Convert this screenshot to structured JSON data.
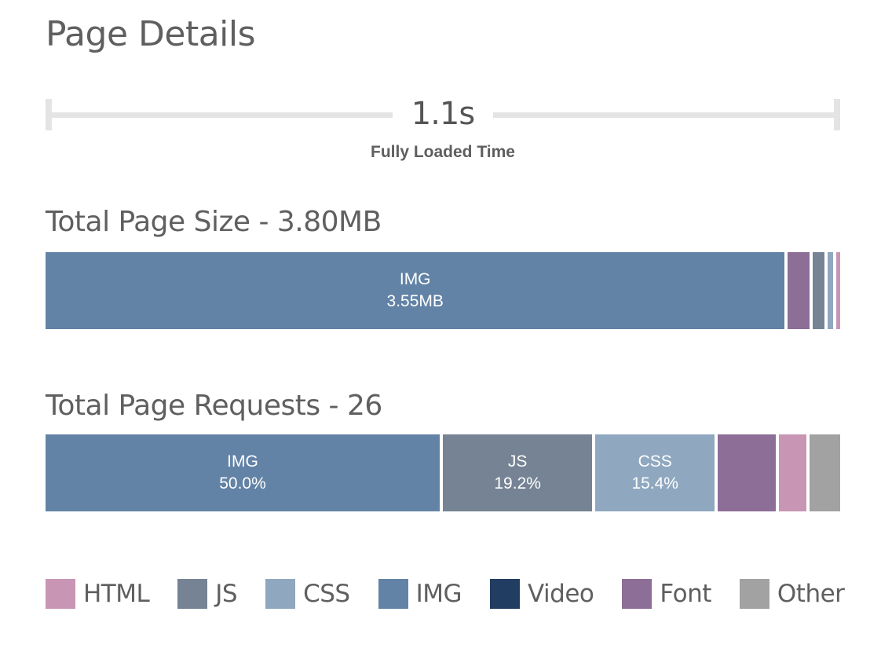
{
  "page_title": "Page Details",
  "timeline": {
    "value": "1.1s",
    "label": "Fully Loaded Time"
  },
  "colors": {
    "HTML": "#c896b4",
    "JS": "#758394",
    "CSS": "#8fa8c0",
    "IMG": "#6283a6",
    "Video": "#213d61",
    "Font": "#8d6e97",
    "Other": "#a2a2a2"
  },
  "chart_data": [
    {
      "type": "bar",
      "title": "Total Page Size - 3.80MB",
      "categories": [
        "IMG",
        "Font",
        "JS",
        "CSS",
        "HTML"
      ],
      "values": [
        3.55,
        0.12,
        0.07,
        0.04,
        0.02
      ],
      "unit": "MB",
      "labels": [
        {
          "category": "IMG",
          "line1": "IMG",
          "line2": "3.55MB"
        }
      ]
    },
    {
      "type": "bar",
      "title": "Total Page Requests - 26",
      "categories": [
        "IMG",
        "JS",
        "CSS",
        "Font",
        "HTML",
        "Other"
      ],
      "values": [
        50.0,
        19.2,
        15.4,
        7.7,
        3.85,
        3.85
      ],
      "unit": "%",
      "labels": [
        {
          "category": "IMG",
          "line1": "IMG",
          "line2": "50.0%"
        },
        {
          "category": "JS",
          "line1": "JS",
          "line2": "19.2%"
        },
        {
          "category": "CSS",
          "line1": "CSS",
          "line2": "15.4%"
        }
      ]
    }
  ],
  "legend": [
    "HTML",
    "JS",
    "CSS",
    "IMG",
    "Video",
    "Font",
    "Other"
  ]
}
